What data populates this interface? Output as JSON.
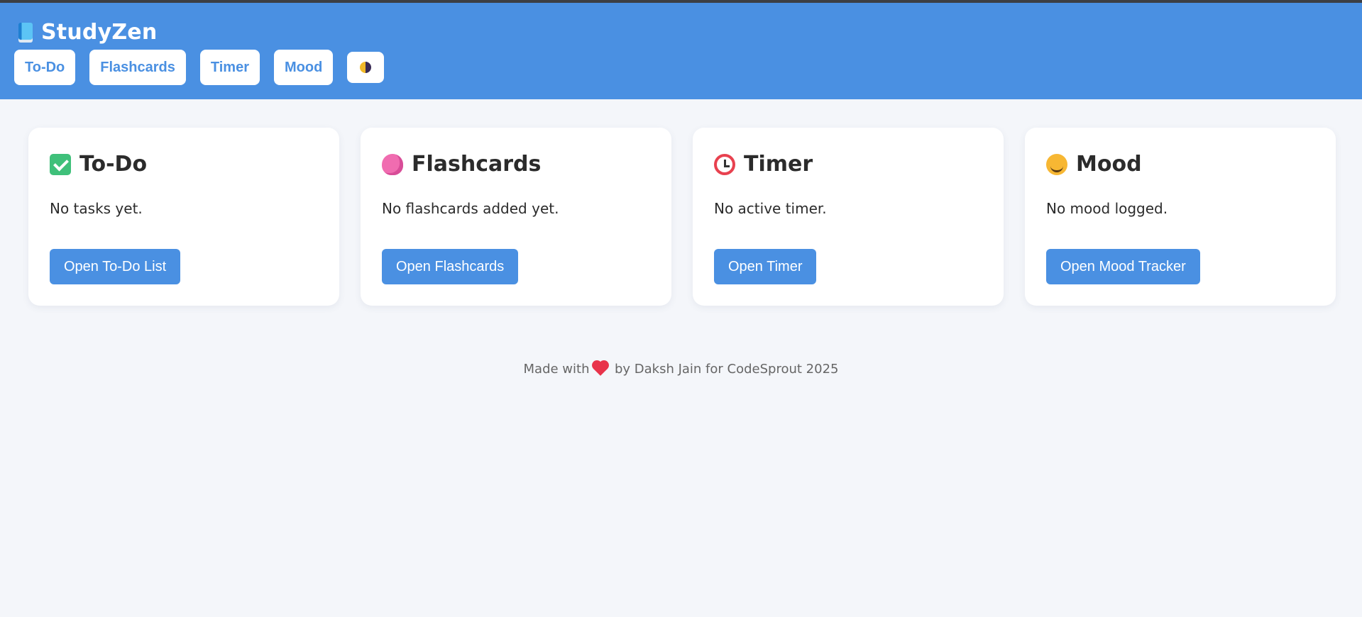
{
  "app": {
    "name": "StudyZen",
    "icon": "book-icon"
  },
  "nav": {
    "items": [
      {
        "label": "To-Do"
      },
      {
        "label": "Flashcards"
      },
      {
        "label": "Timer"
      },
      {
        "label": "Mood"
      }
    ],
    "theme_toggle_icon": "half-moon-icon"
  },
  "cards": [
    {
      "icon": "check-icon",
      "title": "To-Do",
      "text": "No tasks yet.",
      "button": "Open To-Do List"
    },
    {
      "icon": "brain-icon",
      "title": "Flashcards",
      "text": "No flashcards added yet.",
      "button": "Open Flashcards"
    },
    {
      "icon": "alarm-clock-icon",
      "title": "Timer",
      "text": "No active timer.",
      "button": "Open Timer"
    },
    {
      "icon": "smile-icon",
      "title": "Mood",
      "text": "No mood logged.",
      "button": "Open Mood Tracker"
    }
  ],
  "footer": {
    "prefix": "Made with",
    "suffix": "by Daksh Jain for CodeSprout 2025",
    "icon": "heart-icon"
  },
  "colors": {
    "primary": "#4a90e2",
    "background": "#f4f6fa",
    "card": "#ffffff"
  }
}
